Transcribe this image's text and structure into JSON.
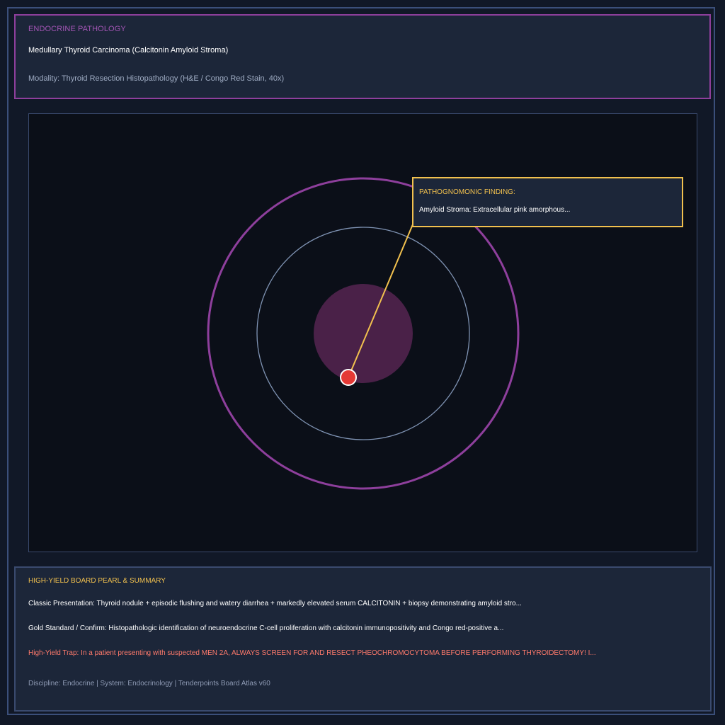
{
  "header": {
    "category": "ENDOCRINE PATHOLOGY",
    "title": "Medullary Thyroid Carcinoma (Calcitonin Amyloid Stroma)",
    "modality": "Modality: Thyroid Resection Histopathology (H&E / Congo Red Stain, 40x)"
  },
  "callout": {
    "label": "PATHOGNOMONIC FINDING:",
    "text": "Amyloid Stroma: Extracellular pink amorphous..."
  },
  "summary": {
    "heading": "HIGH-YIELD BOARD PEARL & SUMMARY",
    "presentation": "Classic Presentation: Thyroid nodule + episodic flushing and watery diarrhea + markedly elevated serum CALCITONIN + biopsy demonstrating amyloid stro...",
    "gold_standard": "Gold Standard / Confirm: Histopathologic identification of neuroendocrine C-cell proliferation with calcitonin immunopositivity and Congo red-positive a...",
    "trap": "High-Yield Trap: In a patient presenting with suspected MEN 2A, ALWAYS SCREEN FOR AND RESECT PHEOCHROMOCYTOMA BEFORE PERFORMING THYROIDECTOMY! I...",
    "footer": "Discipline: Endocrine | System: Endocrinology | Tenderpoints Board Atlas v60"
  },
  "colors": {
    "accent_purple": "#8e3f9c",
    "accent_gold": "#f2c14e",
    "trap_red": "#ff7a6b",
    "marker_red": "#e53935"
  }
}
